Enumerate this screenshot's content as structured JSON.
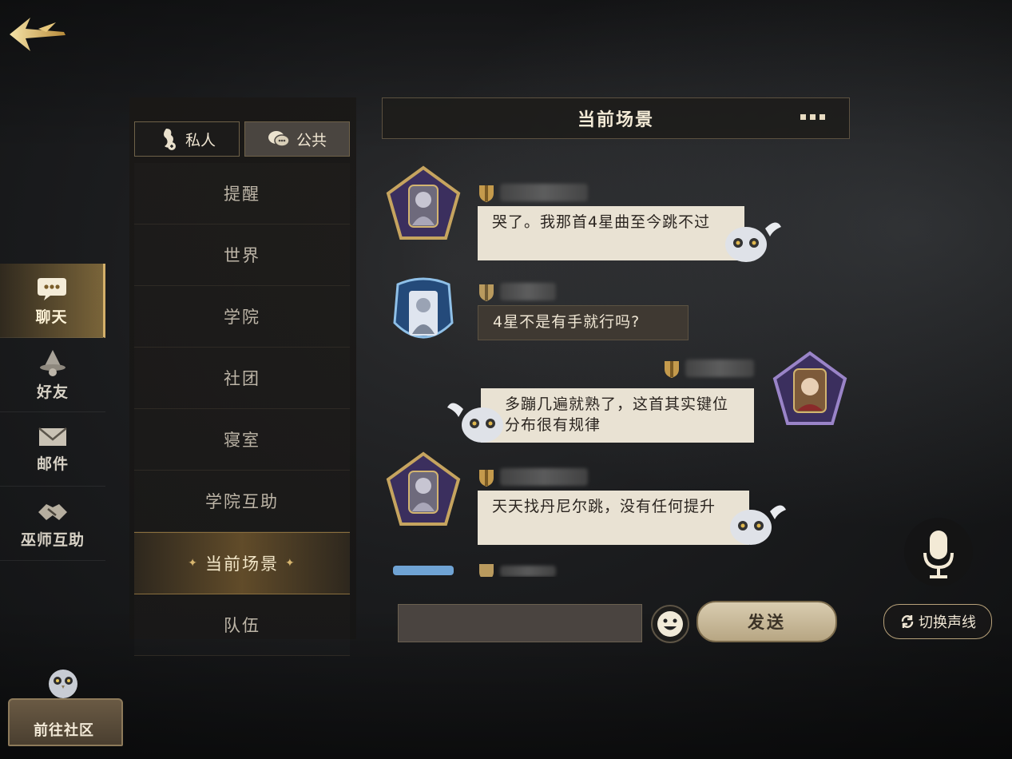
{
  "nav": {
    "items": [
      {
        "label": "聊天",
        "icon": "chat-bubble-icon",
        "active": true
      },
      {
        "label": "好友",
        "icon": "wizard-hat-icon",
        "active": false
      },
      {
        "label": "邮件",
        "icon": "envelope-icon",
        "active": false
      },
      {
        "label": "巫师互助",
        "icon": "handshake-icon",
        "active": false
      }
    ],
    "community_label": "前往社区"
  },
  "tabs": {
    "private_label": "私人",
    "public_label": "公共"
  },
  "channels": [
    "提醒",
    "世界",
    "学院",
    "社团",
    "寝室",
    "学院互助",
    "当前场景",
    "队伍"
  ],
  "active_channel": "当前场景",
  "chat": {
    "title": "当前场景",
    "messages": [
      {
        "side": "left",
        "text": "哭了。我那首4星曲至今跳不过",
        "style": "light",
        "avatar": "pentagon-purple-avatar"
      },
      {
        "side": "left",
        "text": "4星不是有手就行吗?",
        "style": "dark",
        "avatar": "blue-ornate-avatar"
      },
      {
        "side": "right",
        "text": "多蹦几遍就熟了，这首其实键位分布很有规律",
        "style": "light",
        "avatar": "pentagon-girl-avatar"
      },
      {
        "side": "left",
        "text": "天天找丹尼尔跳，没有任何提升",
        "style": "light",
        "avatar": "pentagon-purple-avatar"
      }
    ]
  },
  "input": {
    "placeholder": ""
  },
  "send_label": "发送",
  "switch_line_label": "切换声线",
  "colors": {
    "gold_accent": "#d4b06a",
    "bubble_light": "#e9e2d3",
    "bubble_dark": "#3f3932",
    "background": "#1b1c1e"
  }
}
